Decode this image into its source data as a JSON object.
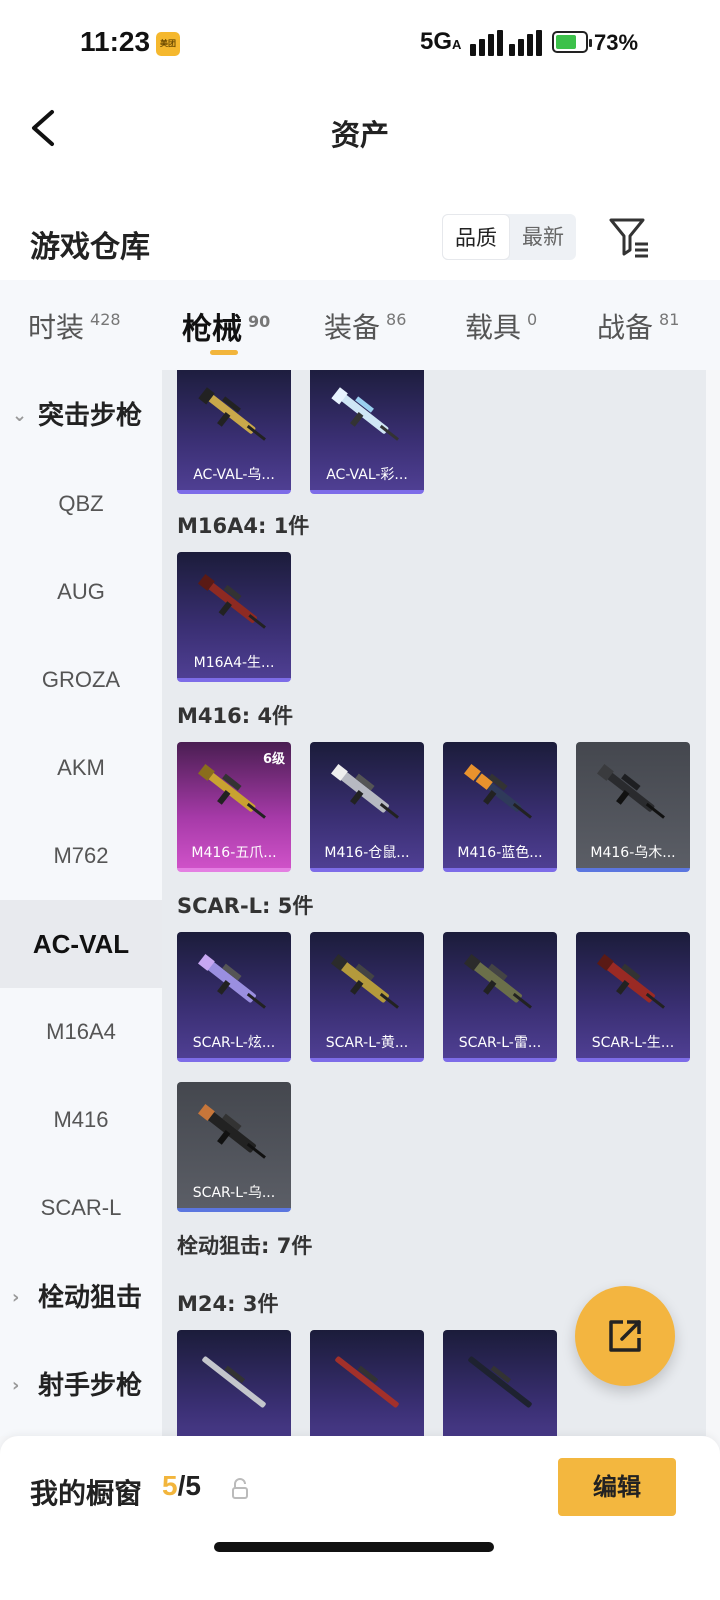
{
  "status_bar": {
    "time": "11:23",
    "app_badge": "美团",
    "network": "5G",
    "network_sub": "A",
    "battery_level": 0.73,
    "battery_text": "73%"
  },
  "nav": {
    "title": "资产",
    "back_icon": "chevron-left-icon"
  },
  "warehouse": {
    "title": "游戏仓库",
    "sort_options": [
      "品质",
      "最新"
    ],
    "active_sort": "品质",
    "filter_icon": "filter-icon"
  },
  "tabs": [
    {
      "label": "时装",
      "count": "428"
    },
    {
      "label": "枪械",
      "count": "90",
      "active": true
    },
    {
      "label": "装备",
      "count": "86"
    },
    {
      "label": "载具",
      "count": "0"
    },
    {
      "label": "战备",
      "count": "81"
    }
  ],
  "sidebar": {
    "items": [
      {
        "label": "突击步枪",
        "type": "group",
        "expanded": true
      },
      {
        "label": "QBZ"
      },
      {
        "label": "AUG"
      },
      {
        "label": "GROZA"
      },
      {
        "label": "AKM"
      },
      {
        "label": "M762"
      },
      {
        "label": "AC-VAL",
        "active": true
      },
      {
        "label": "M16A4"
      },
      {
        "label": "M416"
      },
      {
        "label": "SCAR-L"
      },
      {
        "label": "栓动狙击",
        "type": "group",
        "expanded": false
      },
      {
        "label": "射手步枪",
        "type": "group",
        "expanded": false
      }
    ]
  },
  "sections": [
    {
      "label": "",
      "cards": [
        {
          "name": "AC-VAL-乌...",
          "style": "purple"
        },
        {
          "name": "AC-VAL-彩...",
          "style": "purple"
        }
      ]
    },
    {
      "label": "M16A4: 1件",
      "cards": [
        {
          "name": "M16A4-生...",
          "style": "purple"
        }
      ]
    },
    {
      "label": "M416: 4件",
      "cards": [
        {
          "name": "M416-五爪...",
          "style": "legend",
          "level": "6级"
        },
        {
          "name": "M416-仓鼠...",
          "style": "purple"
        },
        {
          "name": "M416-蓝色...",
          "style": "purple"
        },
        {
          "name": "M416-乌木...",
          "style": "grey"
        }
      ]
    },
    {
      "label": "SCAR-L: 5件",
      "cards": [
        {
          "name": "SCAR-L-炫...",
          "style": "purple"
        },
        {
          "name": "SCAR-L-黄...",
          "style": "purple"
        },
        {
          "name": "SCAR-L-雷...",
          "style": "purple"
        },
        {
          "name": "SCAR-L-生...",
          "style": "purple"
        },
        {
          "name": "SCAR-L-乌...",
          "style": "grey"
        }
      ]
    },
    {
      "label": "栓动狙击: 7件",
      "cards": []
    },
    {
      "label": "M24: 3件",
      "cards": [
        {
          "name": "",
          "style": "purple"
        },
        {
          "name": "",
          "style": "purple"
        },
        {
          "name": "",
          "style": "purple"
        }
      ]
    }
  ],
  "share_button": {
    "icon": "share-icon"
  },
  "showcase": {
    "title": "我的橱窗",
    "current": "5",
    "separator": "/",
    "total": "5",
    "lock_icon": "lock-icon",
    "edit_label": "编辑"
  },
  "colors": {
    "accent": "#f3b73f",
    "card_purple": "#3a2f73",
    "card_legend": "#a63aa8",
    "card_grey": "#5b5e66"
  }
}
